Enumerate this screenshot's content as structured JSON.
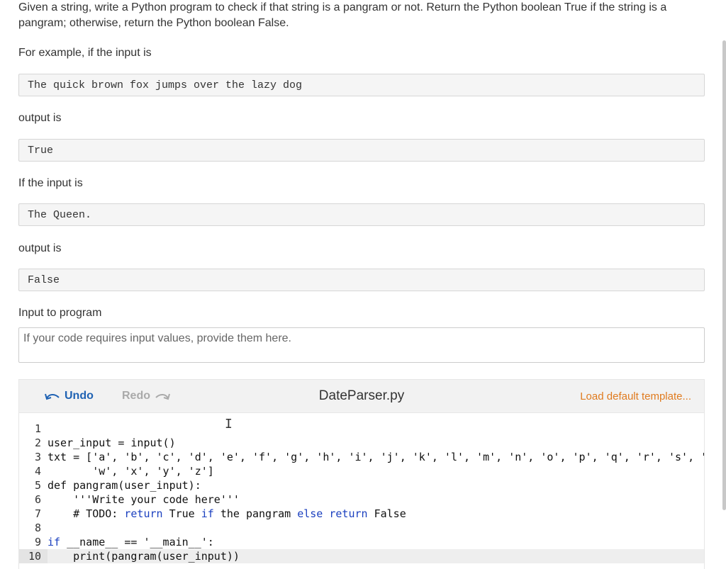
{
  "problem": {
    "intro": "Given a string, write a Python program to check if that string is a pangram or not. Return the Python boolean True if the string is a pangram; otherwise, return the Python boolean False.",
    "example_intro": "For example, if the input is",
    "example1_input": "The quick brown fox jumps over the lazy dog",
    "output_is_1": "output is",
    "example1_output": "True",
    "if_input_is": "If the input is",
    "example2_input": "The Queen.",
    "output_is_2": "output is",
    "example2_output": "False"
  },
  "program_input": {
    "label": "Input to program",
    "placeholder": "If your code requires input values, provide them here."
  },
  "editor": {
    "undo_label": "Undo",
    "redo_label": "Redo",
    "filename": "DateParser.py",
    "load_template_label": "Load default template...",
    "active_line": 10,
    "lines": [
      {
        "num": "1",
        "text": ""
      },
      {
        "num": "2",
        "text": "user_input = input()"
      },
      {
        "num": "3",
        "text": "txt = ['a', 'b', 'c', 'd', 'e', 'f', 'g', 'h', 'i', 'j', 'k', 'l', 'm', 'n', 'o', 'p', 'q', 'r', 's', 't', 'u', 'v',"
      },
      {
        "num": "4",
        "text": "       'w', 'x', 'y', 'z']"
      },
      {
        "num": "5",
        "text": "def pangram(user_input):"
      },
      {
        "num": "6",
        "text": "    '''Write your code here'''"
      },
      {
        "num": "7",
        "text": "    # TODO: return True if the pangram else return False"
      },
      {
        "num": "8",
        "text": ""
      },
      {
        "num": "9",
        "text": "if __name__ == '__main__':"
      },
      {
        "num": "10",
        "text": "    print(pangram(user_input))"
      }
    ]
  },
  "colors": {
    "link_blue": "#1f62b3",
    "load_orange": "#e07b1f",
    "keyword_blue": "#1a3fbf"
  },
  "icons": {
    "undo": "undo-arrow-icon",
    "redo": "redo-arrow-icon",
    "cursor": "text-cursor-icon"
  }
}
